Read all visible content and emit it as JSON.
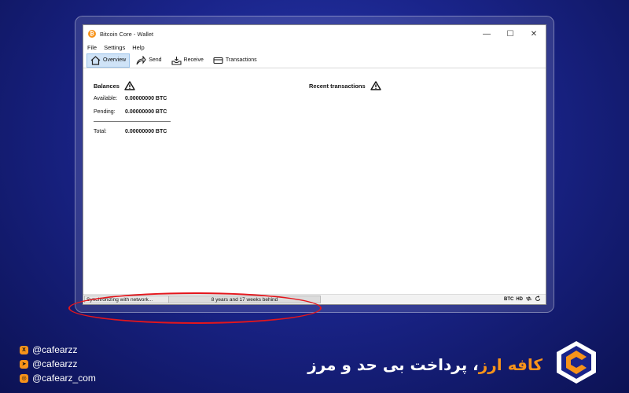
{
  "window": {
    "title": "Bitcoin Core - Wallet",
    "app_icon": "₿",
    "controls": {
      "minimize": "—",
      "maximize": "☐",
      "close": "✕"
    }
  },
  "menu": [
    "File",
    "Settings",
    "Help"
  ],
  "toolbar": {
    "overview": "Overview",
    "send": "Send",
    "receive": "Receive",
    "transactions": "Transactions"
  },
  "balances": {
    "title": "Balances",
    "available_label": "Available:",
    "available_value": "0.00000000 BTC",
    "pending_label": "Pending:",
    "pending_value": "0.00000000 BTC",
    "total_label": "Total:",
    "total_value": "0.00000000 BTC"
  },
  "recent": {
    "title": "Recent transactions"
  },
  "statusbar": {
    "sync_label": "Synchronizing with network...",
    "progress_text": "8 years and 17 weeks behind",
    "unit": "BTC",
    "hd": "HD"
  },
  "footer": {
    "socials": [
      "@cafearzz",
      "@cafearzz",
      "@cafearz_com"
    ],
    "slogan_brand": "کافه ارز",
    "slogan_rest": "، پرداخت بی حد و مرز"
  },
  "colors": {
    "accent": "#f7931a",
    "highlight": "#e4161c",
    "background": "#1a248a"
  }
}
